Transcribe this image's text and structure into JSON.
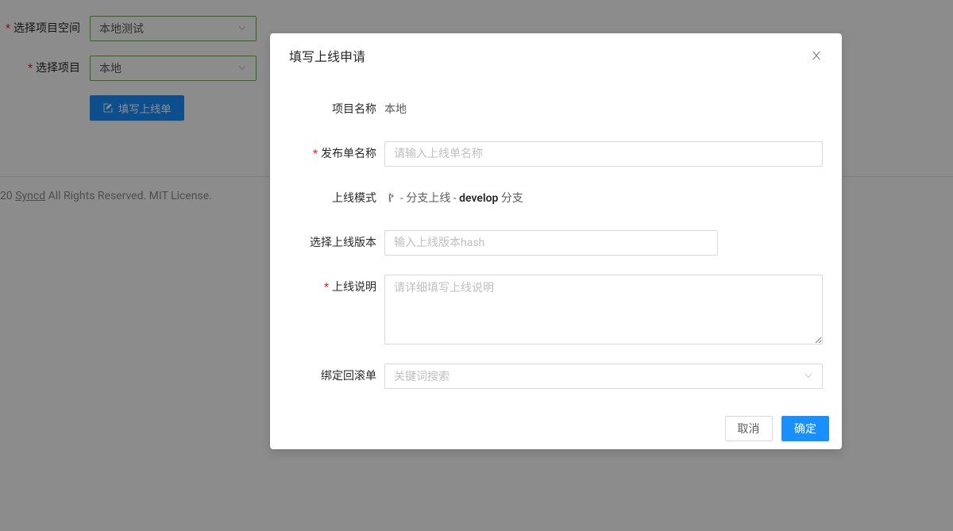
{
  "background": {
    "space_label": "选择项目空间",
    "space_value": "本地测试",
    "project_label": "选择项目",
    "project_value": "本地",
    "fill_button": "填写上线单",
    "footer_year": "20",
    "footer_link": "Syncd",
    "footer_rest": "  All Rights Reserved. MIT License."
  },
  "modal": {
    "title": "填写上线申请",
    "project_name_label": "项目名称",
    "project_name_value": "本地",
    "release_name_label": "发布单名称",
    "release_name_placeholder": "请输入上线单名称",
    "mode_label": "上线模式",
    "mode_prefix": " - 分支上线 - ",
    "mode_branch": "develop",
    "mode_suffix": " 分支",
    "version_label": "选择上线版本",
    "version_placeholder": "输入上线版本hash",
    "desc_label": "上线说明",
    "desc_placeholder": "请详细填写上线说明",
    "rollback_label": "绑定回滚单",
    "rollback_placeholder": "关键词搜索",
    "cancel": "取消",
    "ok": "确定"
  }
}
